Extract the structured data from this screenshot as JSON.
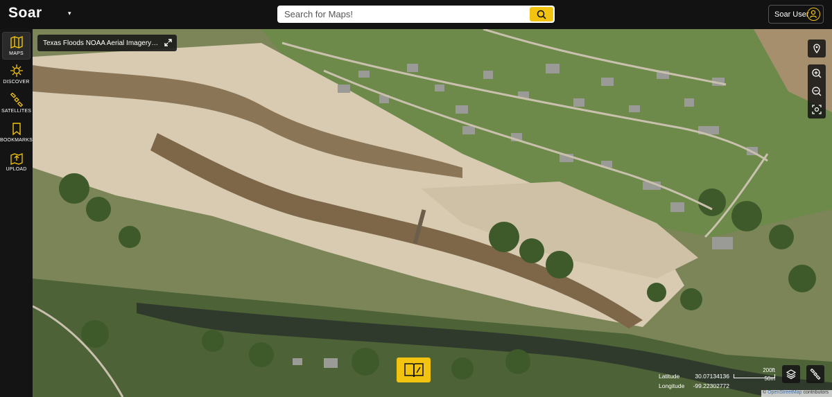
{
  "colors": {
    "accent": "#f2c40f",
    "topbar": "#121212",
    "sidebar": "#141414"
  },
  "header": {
    "logo_text": "Soar",
    "search_placeholder": "Search for Maps!",
    "user_label": "Soar User"
  },
  "sidebar": {
    "items": [
      {
        "label": "MAPS",
        "icon": "map-icon",
        "active": true
      },
      {
        "label": "DISCOVER",
        "icon": "discover-icon",
        "active": false
      },
      {
        "label": "SATELLITES",
        "icon": "satellite-icon",
        "active": false
      },
      {
        "label": "BOOKMARKS",
        "icon": "bookmark-icon",
        "active": false
      },
      {
        "label": "UPLOAD",
        "icon": "upload-icon",
        "active": false
      }
    ]
  },
  "map": {
    "title": "Texas Floods NOAA Aerial Imagery - July...",
    "coords": {
      "lat_label": "Latitude",
      "lat_value": "30.07134136",
      "lon_label": "Longitude",
      "lon_value": "-99.22302772"
    },
    "scale": {
      "top": "200ft",
      "bottom": "50m"
    },
    "attribution": {
      "prefix": "© ",
      "link": "OpenStreetMap",
      "suffix": " contributors"
    }
  }
}
